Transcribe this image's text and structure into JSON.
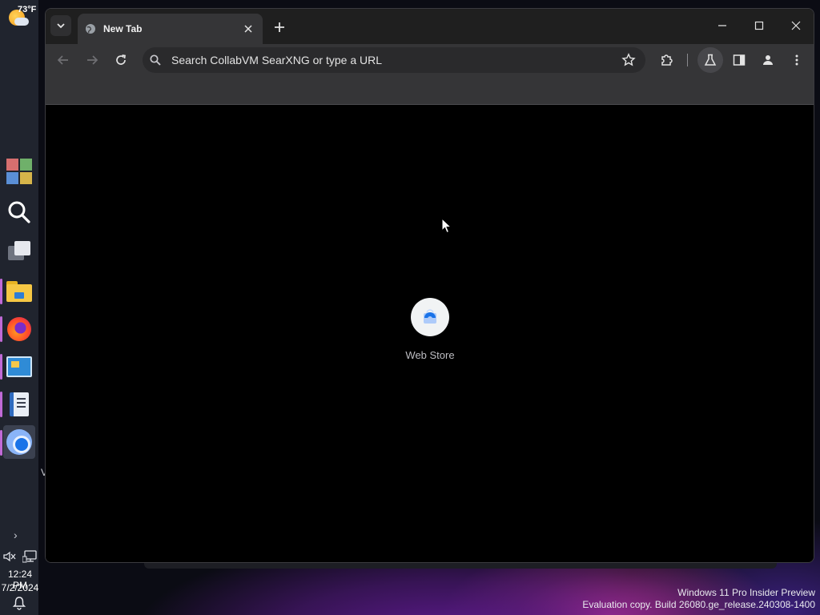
{
  "taskbar": {
    "weather_temp": "73°F",
    "apps": [
      {
        "name": "start",
        "icon": "windows-start-icon"
      },
      {
        "name": "search",
        "icon": "search-icon"
      },
      {
        "name": "task-view",
        "icon": "task-view-icon"
      },
      {
        "name": "file-explorer",
        "icon": "folder-icon"
      },
      {
        "name": "firefox",
        "icon": "firefox-icon"
      },
      {
        "name": "control-panel",
        "icon": "control-panel-icon"
      },
      {
        "name": "notepad",
        "icon": "notepad-icon"
      },
      {
        "name": "chromium",
        "icon": "chromium-icon"
      }
    ],
    "chevron": "›",
    "time": "12:24 PM",
    "date": "7/2/2024"
  },
  "browser": {
    "tab_title": "New Tab",
    "omnibox_placeholder": "Search CollabVM SearXNG or type a URL",
    "shortcuts": [
      {
        "label": "Web Store",
        "icon": "web-store-icon"
      }
    ]
  },
  "desktop": {
    "partial_text": "V",
    "watermark_line1": "Windows 11 Pro Insider Preview",
    "watermark_line2": "Evaluation copy. Build 26080.ge_release.240308-1400"
  },
  "colors": {
    "taskbar_bg": "#20242e",
    "titlebar_bg": "#1f1f1f",
    "toolbar_bg": "#353537",
    "omnibox_bg": "#2a2a2c",
    "content_bg": "#000000",
    "accent_indicator": "#c06ad6"
  }
}
